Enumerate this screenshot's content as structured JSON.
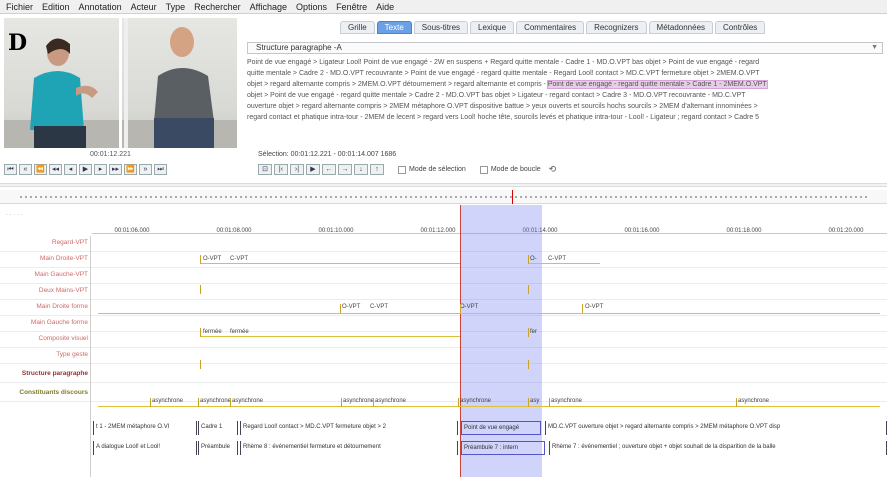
{
  "menu": [
    "Fichier",
    "Edition",
    "Annotation",
    "Acteur",
    "Type",
    "Rechercher",
    "Affichage",
    "Options",
    "Fenêtre",
    "Aide"
  ],
  "panel_label": "D",
  "video": {
    "timestamp": "00:01:12.221"
  },
  "tabs": [
    "Grille",
    "Texte",
    "Sous-titres",
    "Lexique",
    "Commentaires",
    "Recognizers",
    "Métadonnées",
    "Contrôles"
  ],
  "active_tab": "Texte",
  "tier_select": "Structure paragraphe -A",
  "text_lines": [
    "Point de vue engagé > Ligateur Lool! Point de vue engagé - 2W en suspens + Regard quitte mentale - Cadre 1 - MD.O.VPT bas objet > Point de vue engagé - regard",
    "quitte mentale > Cadre 2 - MD.O.VPT recouvrante > Point de vue engagé - regard quitte mentale - Regard Lool! contact > MD.C.VPT fermeture objet > 2MEM.O.VPT",
    "objet > regard alternante compris > 2MEM.O.VPT détournement > regard alternante et compris -",
    "objet > Point de vue engagé - regard quitte mentale > Cadre 2 - MD.O.VPT bas objet > Ligateur - regard contact > Cadre 3 - MD.O.VPT recouvrante - MD.C.VPT",
    "ouverture objet > regard alternante compris > 2MEM métaphore O.VPT dispositive battue > yeux ouverts et sourcils hochs sourcils > 2MEM d'alternant innominées >",
    "regard contact et phatique intra-tour - 2MEM de lecent > regard vers Lool! hoche tête, sourcils levés et phatique intra-tour - Lool! - Ligateur ; regard contact > Cadre 5"
  ],
  "highlight_text": "Point de vue engagé - regard quitte mentale > Cadre 1 - 2MEM.O.VPT",
  "selection_info": "Sélection: 00:01:12.221 - 00:01:14.007  1686",
  "mode_selection": "Mode de sélection",
  "mode_boucle": "Mode de boucle",
  "ruler_ticks": [
    "00:01:06.000",
    "00:01:08.000",
    "00:01:10.000",
    "00:01:12.000",
    "00:01:14.000",
    "00:01:16.000",
    "00:01:18.000",
    "00:01:20.000"
  ],
  "tiers": [
    "Regard-VPT",
    "Main Droite-VPT",
    "Main Gauche-VPT",
    "Deux Mains-VPT",
    "Main Droite forme",
    "Main Gauche forme",
    "Composite visuel",
    "Type geste",
    "Structure paragraphe",
    "Constituants discours"
  ],
  "annotations": {
    "md_vpt": [
      "O-VPT",
      "C-VPT",
      "O-",
      "C-VPT"
    ],
    "deux_vpt": [
      "O-VPT",
      "C-VPT",
      "O-VPT",
      "O-VPT"
    ],
    "md_forme": [
      "fermée",
      "fermée",
      "fer"
    ],
    "type_geste": [
      "asynchrone",
      "asynchrone",
      "asynchrone",
      "asynchrone",
      "asynchrone",
      "asynchrone",
      "asy",
      "asynchrone",
      "asynchrone"
    ],
    "structure": [
      "t 1 - 2MEM métaphore O.VI",
      "Cadre 1",
      "Regard Lool! contact > MD.C.VPT fermeture objet > 2",
      "Point de vue engagé",
      "MD.C.VPT ouverture objet > regard alternante compris > 2MEM métaphore O.VPT disp"
    ],
    "constituants": [
      "A dialogue Lool! et Lool!",
      "Préambule",
      "Rhème 8 : événementiel fermeture et détournement",
      "Préambule 7 : intern",
      "Rhème 7 : événementiel ; ouverture objet + objet souhait de la disparition de la balle"
    ]
  },
  "colors": {
    "accent": "#6aa0e6",
    "selection": "#7882f0",
    "cursor": "#cc3344",
    "tier_text": "#d06a6a"
  }
}
